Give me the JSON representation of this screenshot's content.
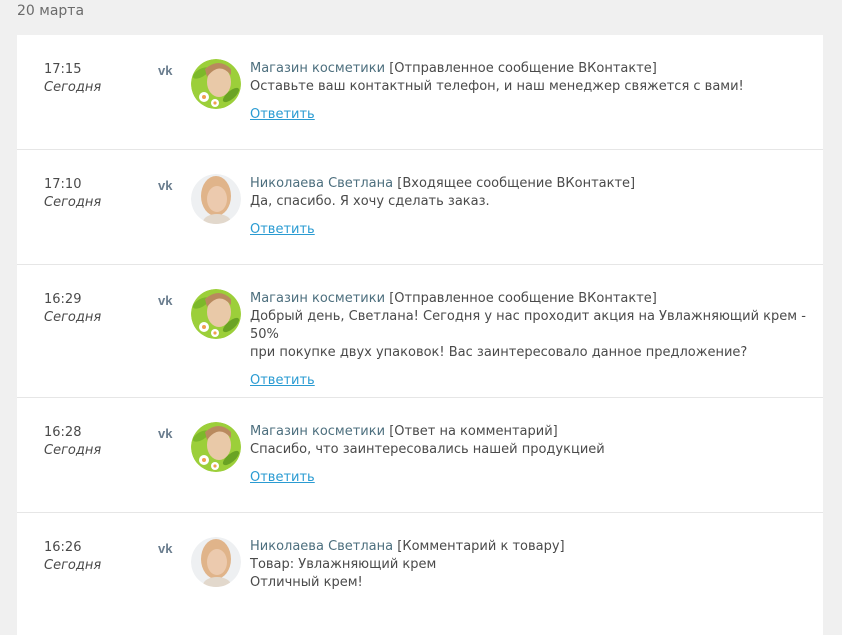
{
  "date_header": "20 марта",
  "reply_label": "Ответить",
  "colors": {
    "author": "#4d6f7e",
    "link": "#2a9bd2",
    "background": "#f0f0f0",
    "vk_icon": "#6a7d8e"
  },
  "entries": [
    {
      "time": "17:15",
      "day": "Сегодня",
      "network_icon": "vk-icon",
      "avatar": "shop-avatar",
      "author": "Магазин косметики",
      "kind": "[Отправленное сообщение ВКонтакте]",
      "lines": [
        "Оставьте ваш контактный телефон, и наш менеджер свяжется с вами!"
      ],
      "has_reply": true
    },
    {
      "time": "17:10",
      "day": "Сегодня",
      "network_icon": "vk-icon",
      "avatar": "user-avatar",
      "author": "Николаева Светлана",
      "kind": "[Входящее сообщение ВКонтакте]",
      "lines": [
        "Да, спасибо. Я хочу сделать заказ."
      ],
      "has_reply": true
    },
    {
      "time": "16:29",
      "day": "Сегодня",
      "network_icon": "vk-icon",
      "avatar": "shop-avatar",
      "author": "Магазин косметики",
      "kind": "[Отправленное сообщение ВКонтакте]",
      "lines": [
        "Добрый день, Светлана! Сегодня у нас проходит акция на Увлажняющий крем - 50%",
        "при покупке двух упаковок! Вас заинтересовало данное предложение?"
      ],
      "has_reply": true
    },
    {
      "time": "16:28",
      "day": "Сегодня",
      "network_icon": "vk-icon",
      "avatar": "shop-avatar",
      "author": "Магазин косметики",
      "kind": "[Ответ на комментарий]",
      "lines": [
        "Спасибо, что заинтересовались нашей продукцией"
      ],
      "has_reply": true
    },
    {
      "time": "16:26",
      "day": "Сегодня",
      "network_icon": "vk-icon",
      "avatar": "user-avatar",
      "author": "Николаева Светлана",
      "kind": "[Комментарий к товару]",
      "lines": [
        "Товар: Увлажняющий крем",
        "Отличный крем!"
      ],
      "has_reply": false
    }
  ]
}
